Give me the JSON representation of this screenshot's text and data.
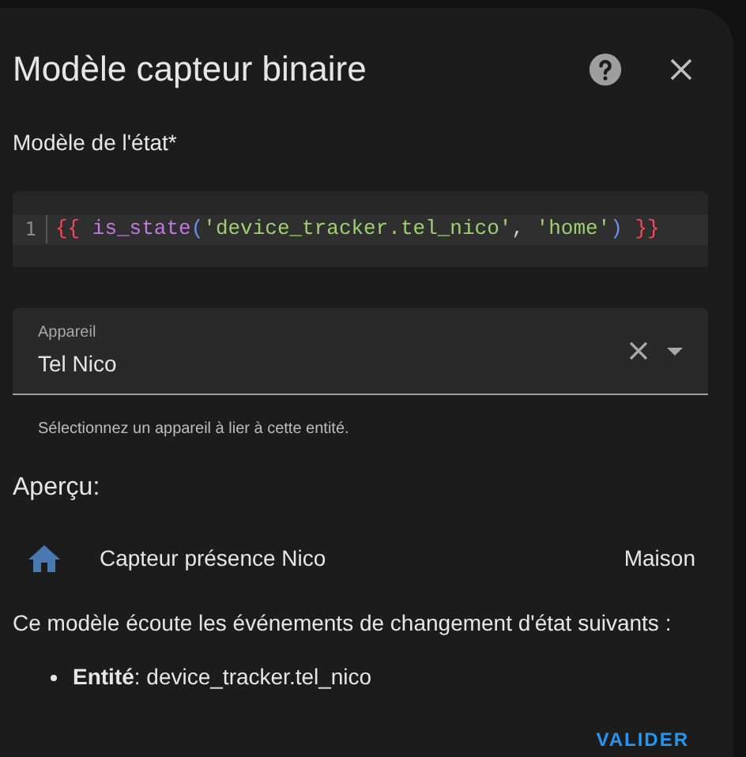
{
  "dialog": {
    "title": "Modèle capteur binaire"
  },
  "template": {
    "label": "Modèle de l'état*",
    "line_number": "1",
    "tokens": [
      {
        "kind": "brace",
        "text": "{{"
      },
      {
        "kind": "function",
        "text": "is_state",
        "space_before": true
      },
      {
        "kind": "paren",
        "text": "("
      },
      {
        "kind": "string",
        "text": "'device_tracker.tel_nico'"
      },
      {
        "kind": "plain",
        "text": ", "
      },
      {
        "kind": "string",
        "text": "'home'"
      },
      {
        "kind": "paren",
        "text": ")"
      },
      {
        "kind": "brace",
        "text": "}}",
        "space_before": true
      }
    ]
  },
  "device": {
    "label": "Appareil",
    "value": "Tel Nico",
    "helper": "Sélectionnez un appareil à lier à cette entité."
  },
  "preview": {
    "heading": "Aperçu:",
    "entity_name": "Capteur présence Nico",
    "state": "Maison"
  },
  "listeners": {
    "intro": "Ce modèle écoute les événements de changement d'état suivants :",
    "items": [
      "**Entité**: device_tracker.tel_nico"
    ]
  },
  "actions": [
    "VALIDER"
  ]
}
